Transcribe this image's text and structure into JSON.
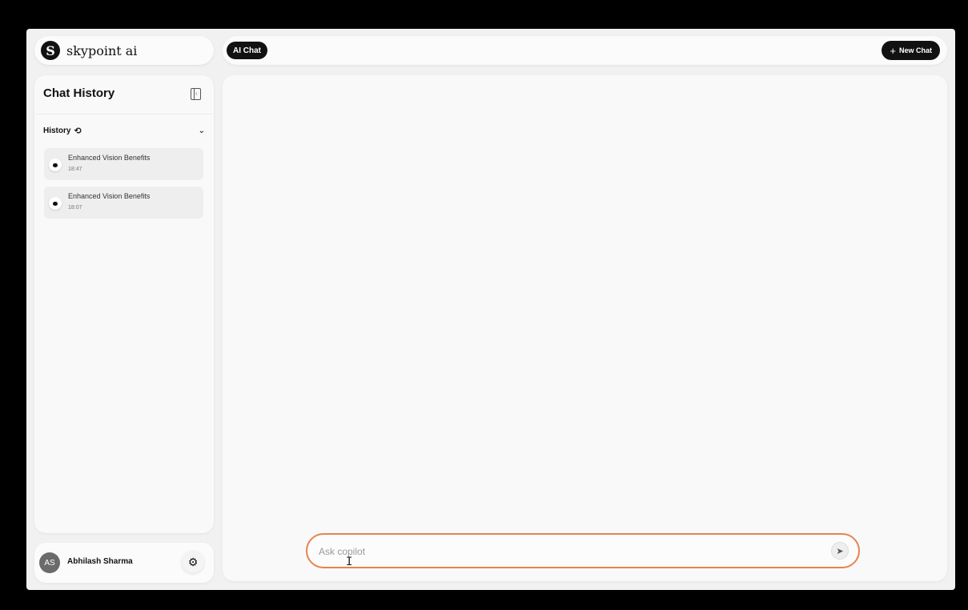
{
  "brand": {
    "logo_letter": "S",
    "name": "skypoint ai"
  },
  "header": {
    "active_tab": "AI Chat",
    "new_chat_label": "New Chat",
    "new_chat_icon": "+"
  },
  "sidebar": {
    "title": "Chat History",
    "history_label": "History",
    "history_icon": "⟲",
    "chevron": "⌄",
    "items": [
      {
        "title": "Enhanced Vision Benefits",
        "time": "18:47"
      },
      {
        "title": "Enhanced Vision Benefits",
        "time": "18:07"
      }
    ]
  },
  "user": {
    "initials": "AS",
    "name": "Abhilash Sharma",
    "settings_icon": "⚙"
  },
  "composer": {
    "placeholder": "Ask copilot",
    "send_icon": "➤"
  },
  "colors": {
    "accent_border": "#e7834f",
    "dark": "#111111"
  }
}
